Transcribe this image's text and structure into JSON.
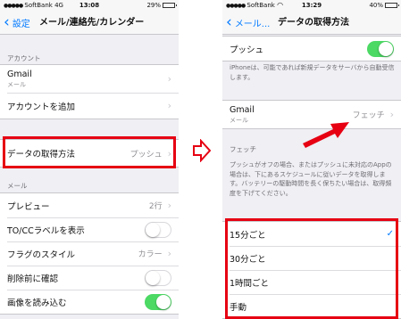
{
  "left": {
    "status": {
      "carrier": "SoftBank",
      "network": "4G",
      "time": "13:08",
      "battery": "29%",
      "battery_level": 0.29
    },
    "nav": {
      "back_label": "設定",
      "title": "メール/連絡先/カレンダー"
    },
    "accounts": {
      "header": "アカウント",
      "gmail_label": "Gmail",
      "gmail_sub": "メール",
      "add_label": "アカウントを追加"
    },
    "fetch_row": {
      "label": "データの取得方法",
      "value": "プッシュ"
    },
    "mail": {
      "header": "メール",
      "preview_label": "プレビュー",
      "preview_value": "2行",
      "tocc_label": "TO/CCラベルを表示",
      "tocc_on": false,
      "flag_label": "フラグのスタイル",
      "flag_value": "カラー",
      "delete_label": "削除前に確認",
      "delete_on": false,
      "images_label": "画像を読み込む",
      "images_on": true
    }
  },
  "right": {
    "status": {
      "carrier": "SoftBank",
      "time": "13:29",
      "battery": "40%",
      "battery_level": 0.4
    },
    "nav": {
      "back_label": "メール...",
      "title": "データの取得方法"
    },
    "push": {
      "label": "プッシュ",
      "on": true
    },
    "push_note": "iPhoneは、可能であれば新規データをサーバから自動受信します。",
    "gmail": {
      "label": "Gmail",
      "sub": "メール",
      "value": "フェッチ"
    },
    "fetch_header": "フェッチ",
    "fetch_note": "プッシュがオフの場合、またはプッシュに未対応のAppの場合は、下にあるスケジュールに従いデータを取得します。バッテリーの駆動時間を長く保ちたい場合は、取得頻度を下げてください。",
    "options": [
      {
        "label": "15分ごと",
        "selected": true
      },
      {
        "label": "30分ごと",
        "selected": false
      },
      {
        "label": "1時間ごと",
        "selected": false
      },
      {
        "label": "手動",
        "selected": false
      }
    ]
  },
  "colors": {
    "accent": "#007aff",
    "highlight": "#e60012",
    "switch_on": "#4cd964"
  },
  "icons": {
    "back": "chevron-left-icon",
    "disclosure": "chevron-right-icon",
    "check": "checkmark-icon",
    "arrow": "arrow-icon"
  }
}
